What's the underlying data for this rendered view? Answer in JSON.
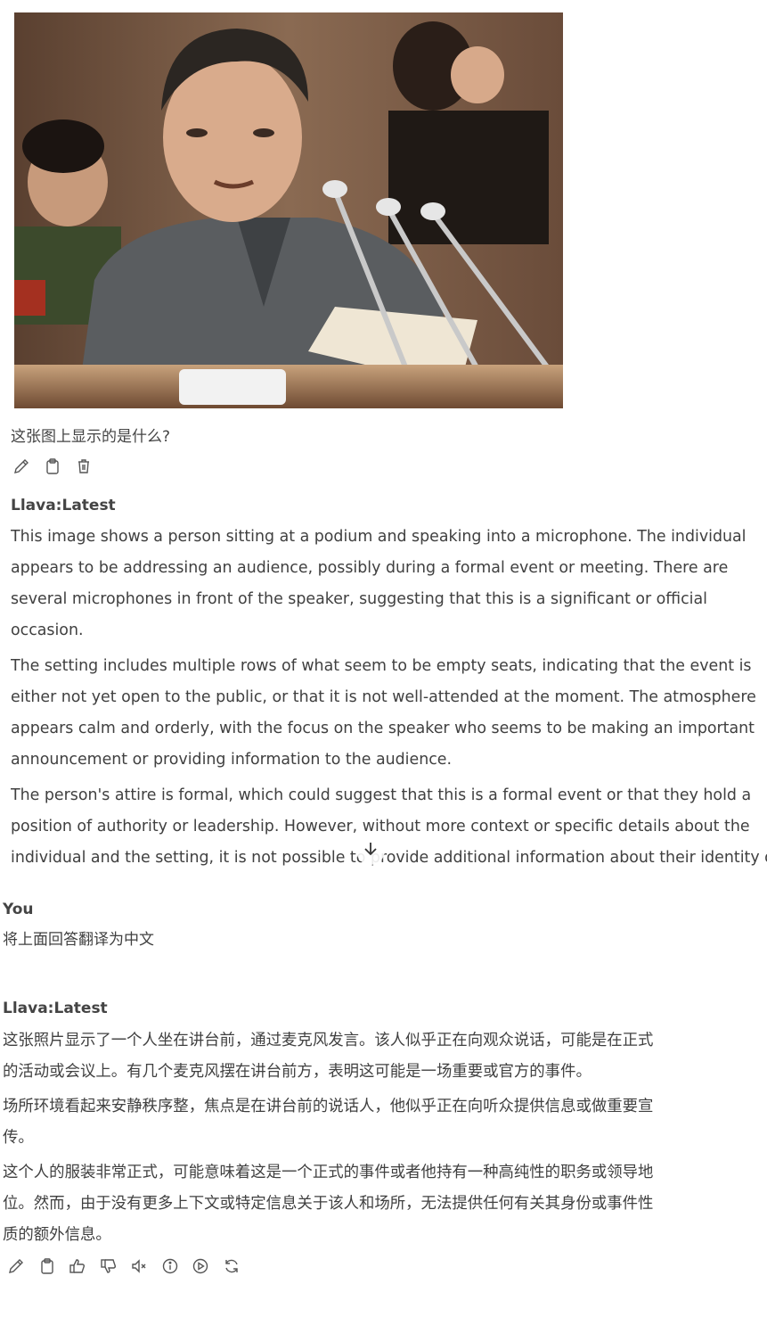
{
  "photo": {
    "alt": "photo",
    "accent": "#7a5a45"
  },
  "user_question": {
    "text": "这张图上显示的是什么?"
  },
  "question_actions": {
    "icons": [
      "pencil-icon",
      "clipboard-icon",
      "trash-icon"
    ]
  },
  "assistant_1": {
    "name": "Llava:Latest",
    "paragraphs": [
      "This image shows a person sitting at a podium and speaking into a microphone. The individual\nappears to be addressing an audience, possibly during a formal event or meeting. There are\nseveral microphones in front of the speaker, suggesting that this is a significant or official\noccasion.",
      "The setting includes multiple rows of what seem to be empty seats, indicating that the event is\neither not yet open to the public, or that it is not well-attended at the moment. The atmosphere\nappears calm and orderly, with the focus on the speaker who seems to be making an important\nannouncement or providing information to the audience.",
      "The person's attire is formal, which could suggest that this is a formal event or that they hold a\nposition of authority or leadership. However, without more context or specific details about the\nindividual and the setting, it is not possible to provide additional information about their identity o"
    ]
  },
  "scroll_down": {
    "icon": "arrow-down-icon"
  },
  "user_2": {
    "name": "You",
    "text": "将上面回答翻译为中文"
  },
  "assistant_2": {
    "name": "Llava:Latest",
    "paragraphs": [
      "这张照片显示了一个人坐在讲台前，通过麦克风发言。该人似乎正在向观众说话，可能是在正式\n的活动或会议上。有几个麦克风摆在讲台前方，表明这可能是一场重要或官方的事件。",
      "场所环境看起来安静秩序整，焦点是在讲台前的说话人，他似乎正在向听众提供信息或做重要宣\n传。",
      "这个人的服装非常正式，可能意味着这是一个正式的事件或者他持有一种高纯性的职务或领导地\n位。然而，由于没有更多上下文或特定信息关于该人和场所，无法提供任何有关其身份或事件性\n质的额外信息。"
    ]
  },
  "response_actions": {
    "icons": [
      "pencil-icon",
      "clipboard-icon",
      "thumbs-up-icon",
      "thumbs-down-icon",
      "speaker-mute-icon",
      "info-icon",
      "play-icon",
      "regenerate-icon"
    ]
  }
}
